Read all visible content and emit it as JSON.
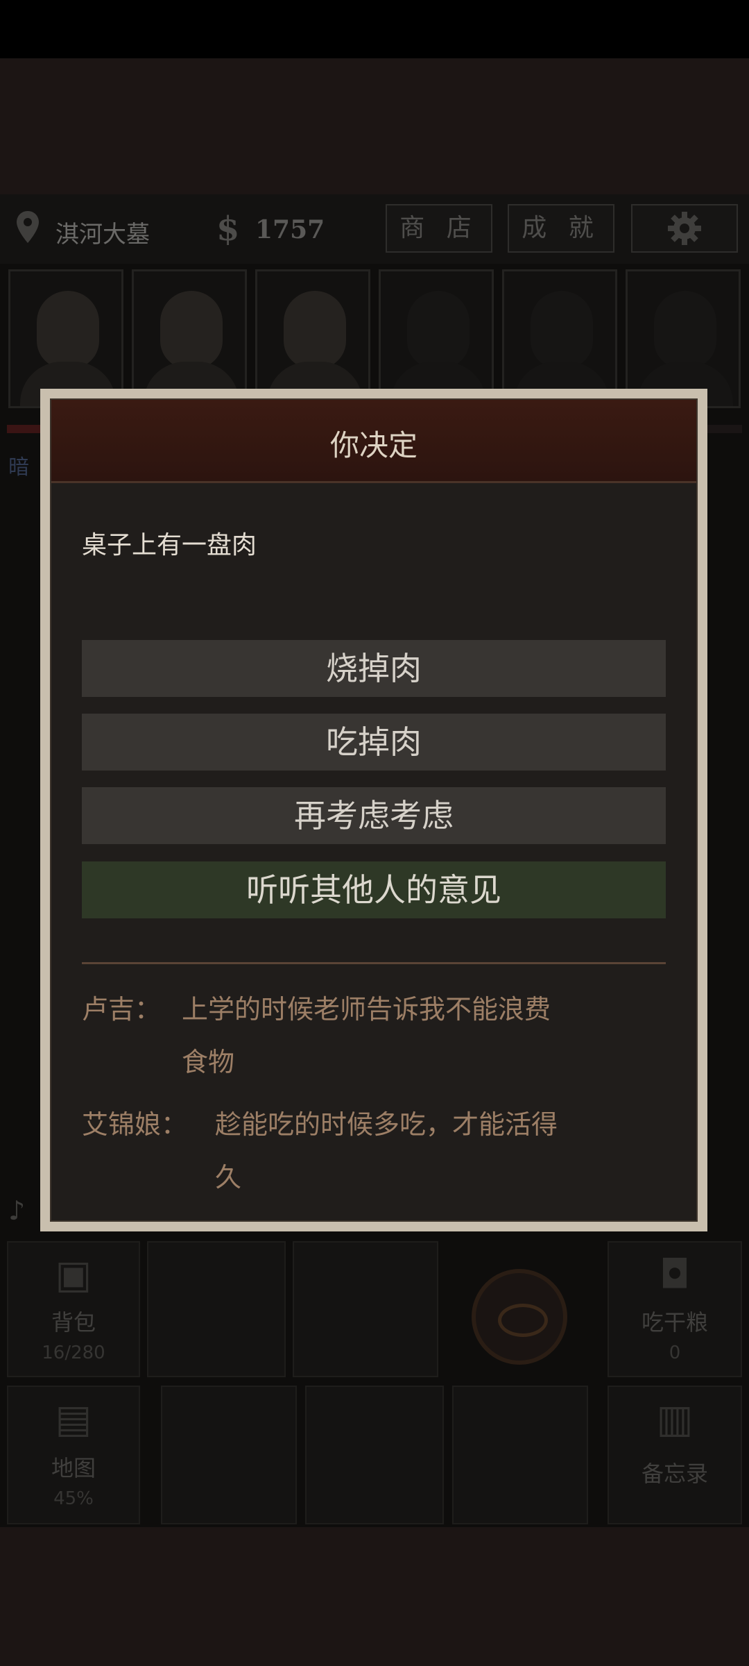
{
  "topbar": {
    "location": "淇河大墓",
    "money_symbol": "$",
    "money": "1757",
    "shop_label": "商 店",
    "achievements_label": "成 就",
    "settings_icon": "gear-icon"
  },
  "side_tag": "暗",
  "dialog": {
    "title": "你决定",
    "prompt": "桌子上有一盘肉",
    "choices": [
      {
        "label": "烧掉肉"
      },
      {
        "label": "吃掉肉"
      },
      {
        "label": "再考虑考虑"
      },
      {
        "label": "听听其他人的意见",
        "highlight_color": "#2e3826"
      }
    ],
    "opinions": [
      {
        "name": "卢吉：",
        "line1": "上学的时候老师告诉我不能浪费",
        "line2": "食物"
      },
      {
        "name": "艾锦娘：",
        "line1": "趁能吃的时候多吃，才能活得",
        "line2": "久"
      }
    ]
  },
  "bottom_menu": {
    "backpack_label": "背包",
    "backpack_count": "16/280",
    "rations_label": "吃干粮",
    "rations_count": "0",
    "map_label": "地图",
    "map_progress": "45%",
    "memo_label": "备忘录"
  },
  "colors": {
    "accent_red": "#3a1a12",
    "highlight_green": "#2e3826",
    "opinion_text": "#9d7f66"
  }
}
